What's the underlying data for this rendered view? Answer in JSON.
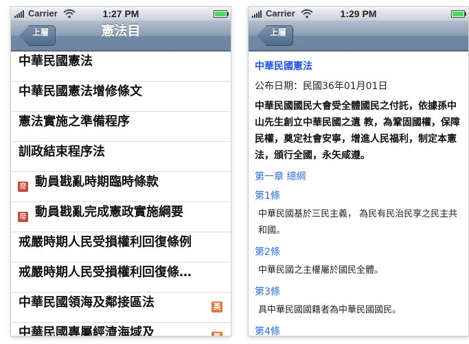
{
  "left": {
    "status": {
      "carrier": "Carrier",
      "time": "1:27 PM"
    },
    "nav": {
      "back_label": "上層",
      "title": "憲法目"
    },
    "rows": [
      {
        "label": "中華民國憲法",
        "icon": "",
        "tag": ""
      },
      {
        "label": "中華民國憲法增修條文",
        "icon": "",
        "tag": ""
      },
      {
        "label": "憲法實施之準備程序",
        "icon": "",
        "tag": ""
      },
      {
        "label": "訓政結束程序法",
        "icon": "",
        "tag": ""
      },
      {
        "label": "動員戡亂時期臨時條款",
        "icon": "廢",
        "tag": ""
      },
      {
        "label": "動員戡亂完成憲政實施綱要",
        "icon": "廢",
        "tag": ""
      },
      {
        "label": "戒嚴時期人民受損權利回復條例",
        "icon": "",
        "tag": ""
      },
      {
        "label": "戒嚴時期人民受損權利回復條…",
        "icon": "",
        "tag": ""
      },
      {
        "label": "中華民國領海及鄰接區法",
        "icon": "",
        "tag": "英"
      },
      {
        "label": "中華民國專屬經濟海域及",
        "icon": "",
        "tag": "英"
      }
    ]
  },
  "right": {
    "status": {
      "carrier": "Carrier",
      "time": "1:29 PM"
    },
    "nav": {
      "back_label": "上層"
    },
    "doc": {
      "title": "中華民國憲法",
      "date": "公布日期：民國36年01月01日",
      "preamble": "中華民國國民大會受全體國民之付託，依據孫中山先生創立中華民國之遺 教，為鞏固國權，保障民權，奠定社會安寧，增進人民福利，制定本憲法，頒行全國，永矢咸遵。",
      "chapter": "第一章 總綱",
      "articles": [
        {
          "heading": "第1條",
          "text": "中華民國基於三民主義， 為民有民治民享之民主共和國。"
        },
        {
          "heading": "第2條",
          "text": "中華民國之主權屬於國民全體。"
        },
        {
          "heading": "第3條",
          "text": "具中華民國國籍者為中華民國國民。"
        },
        {
          "heading": "第4條",
          "text": ""
        }
      ]
    }
  },
  "colors": {
    "nav_blue": "#6d85a2",
    "link_blue": "#2255d8",
    "abolished_icon": "#c44a3a",
    "english_tag": "#e0773c"
  }
}
